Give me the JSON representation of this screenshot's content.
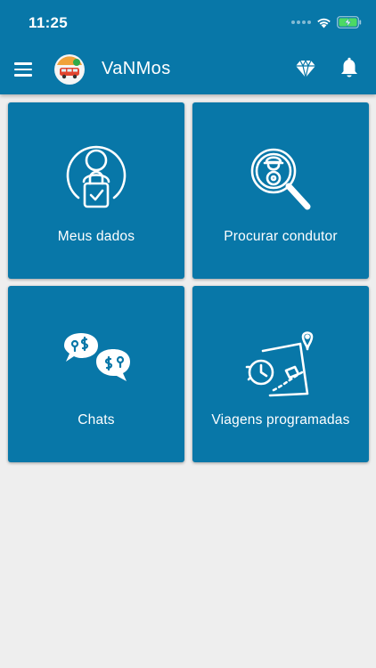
{
  "status_bar": {
    "time": "11:25"
  },
  "app_bar": {
    "title": "VaNMos",
    "menu_icon": "hamburger-menu-icon",
    "logo_icon": "van-logo-icon",
    "premium_icon": "diamond-icon",
    "notifications_icon": "bell-icon"
  },
  "colors": {
    "primary": "#0877a8",
    "background": "#eeeeee",
    "on_primary": "#ffffff"
  },
  "cards": [
    {
      "label": "Meus dados",
      "icon": "user-lock-icon"
    },
    {
      "label": "Procurar condutor",
      "icon": "driver-search-icon"
    },
    {
      "label": "Chats",
      "icon": "chat-bubbles-icon"
    },
    {
      "label": "Viagens programadas",
      "icon": "scheduled-trips-icon"
    }
  ]
}
